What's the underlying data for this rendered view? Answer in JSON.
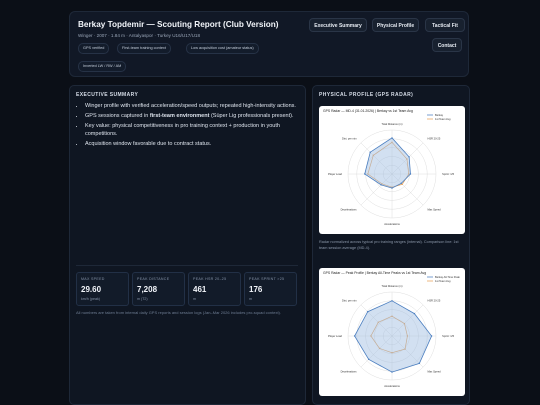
{
  "header": {
    "title": "Berkay Topdemir — Scouting Report (Club Version)",
    "subtitle": "Winger · 2007 · 1.84 m · Antalyaspor · Turkey U16/U17/U18",
    "tags": [
      "GPS verified",
      "First-team training context",
      "Low acquisition cost (amateur status)",
      "Inverted LW / RW / AM"
    ]
  },
  "nav": {
    "executive_summary": "Executive Summary",
    "physical_profile": "Physical Profile",
    "tactical_fit": "Tactical Fit",
    "contact": "Contact"
  },
  "summary": {
    "title": "EXECUTIVE SUMMARY",
    "b1": "Winger profile with verified acceleration/speed outputs; repeated high-intensity actions.",
    "b2_pre": "GPS sessions captured in ",
    "b2_bold": "first-team environment",
    "b2_post": " (Süper Lig professionals present).",
    "b3": "Key value: physical competitiveness in pro training context + production in youth competitions.",
    "b4": "Acquisition window favorable due to contract status.",
    "metrics": [
      {
        "label": "MAX SPEED",
        "value": "29.60",
        "unit": "km/h (peak)"
      },
      {
        "label": "PEAK DISTANCE",
        "value": "7,208",
        "unit": "m (T2)"
      },
      {
        "label": "PEAK HSR 20–25",
        "value": "461",
        "unit": "m"
      },
      {
        "label": "PEAK SPRINT >25",
        "value": "176",
        "unit": "m"
      }
    ],
    "footnote": "All numbers are taken from internal daily GPS reports and session logs (Jan–Mar 2026 includes pro-squad context)."
  },
  "physical": {
    "title": "PHYSICAL PROFILE (GPS RADAR)",
    "caption": "Radar normalized across typical pro training ranges (internal). Comparison line: 1st team session average (MD-4).",
    "colors": {
      "player": "#4c7fc0",
      "team": "#e8a35a",
      "player_fill": "#9cbbe0"
    }
  },
  "chart_data": [
    {
      "type": "radar",
      "title": "GPS Radar — MD-4 (31.01.2026) | Berkay vs 1st Team Avg",
      "axes": [
        "Total Distance (m)",
        "HSR 20-25",
        "Sprint >25",
        "Max Speed",
        "Accelerations",
        "Decelerations",
        "Player Load",
        "Dist. per min"
      ],
      "series": [
        {
          "name": "Berkay",
          "values": [
            0.82,
            0.55,
            0.42,
            0.3,
            0.32,
            0.35,
            0.62,
            0.7
          ]
        },
        {
          "name": "1st Team Avg",
          "values": [
            0.72,
            0.48,
            0.38,
            0.33,
            0.3,
            0.32,
            0.55,
            0.6
          ]
        }
      ],
      "rlim": [
        0,
        1
      ],
      "legend": "top-right"
    },
    {
      "type": "radar",
      "title": "GPS Radar — Peak Profile | Berkay All-Time Peaks vs 1st Team Avg",
      "axes": [
        "Total Distance (m)",
        "HSR 20-25",
        "Sprint >25",
        "Max Speed",
        "Accelerations",
        "Decelerations",
        "Player Load",
        "Dist. per min"
      ],
      "series": [
        {
          "name": "Berkay All-Time Peak",
          "values": [
            0.8,
            0.72,
            0.9,
            0.88,
            0.82,
            0.75,
            0.85,
            0.78
          ]
        },
        {
          "name": "1st Team Avg",
          "values": [
            0.45,
            0.4,
            0.35,
            0.42,
            0.38,
            0.4,
            0.48,
            0.44
          ]
        }
      ],
      "rlim": [
        0,
        1
      ],
      "legend": "top-right"
    }
  ]
}
